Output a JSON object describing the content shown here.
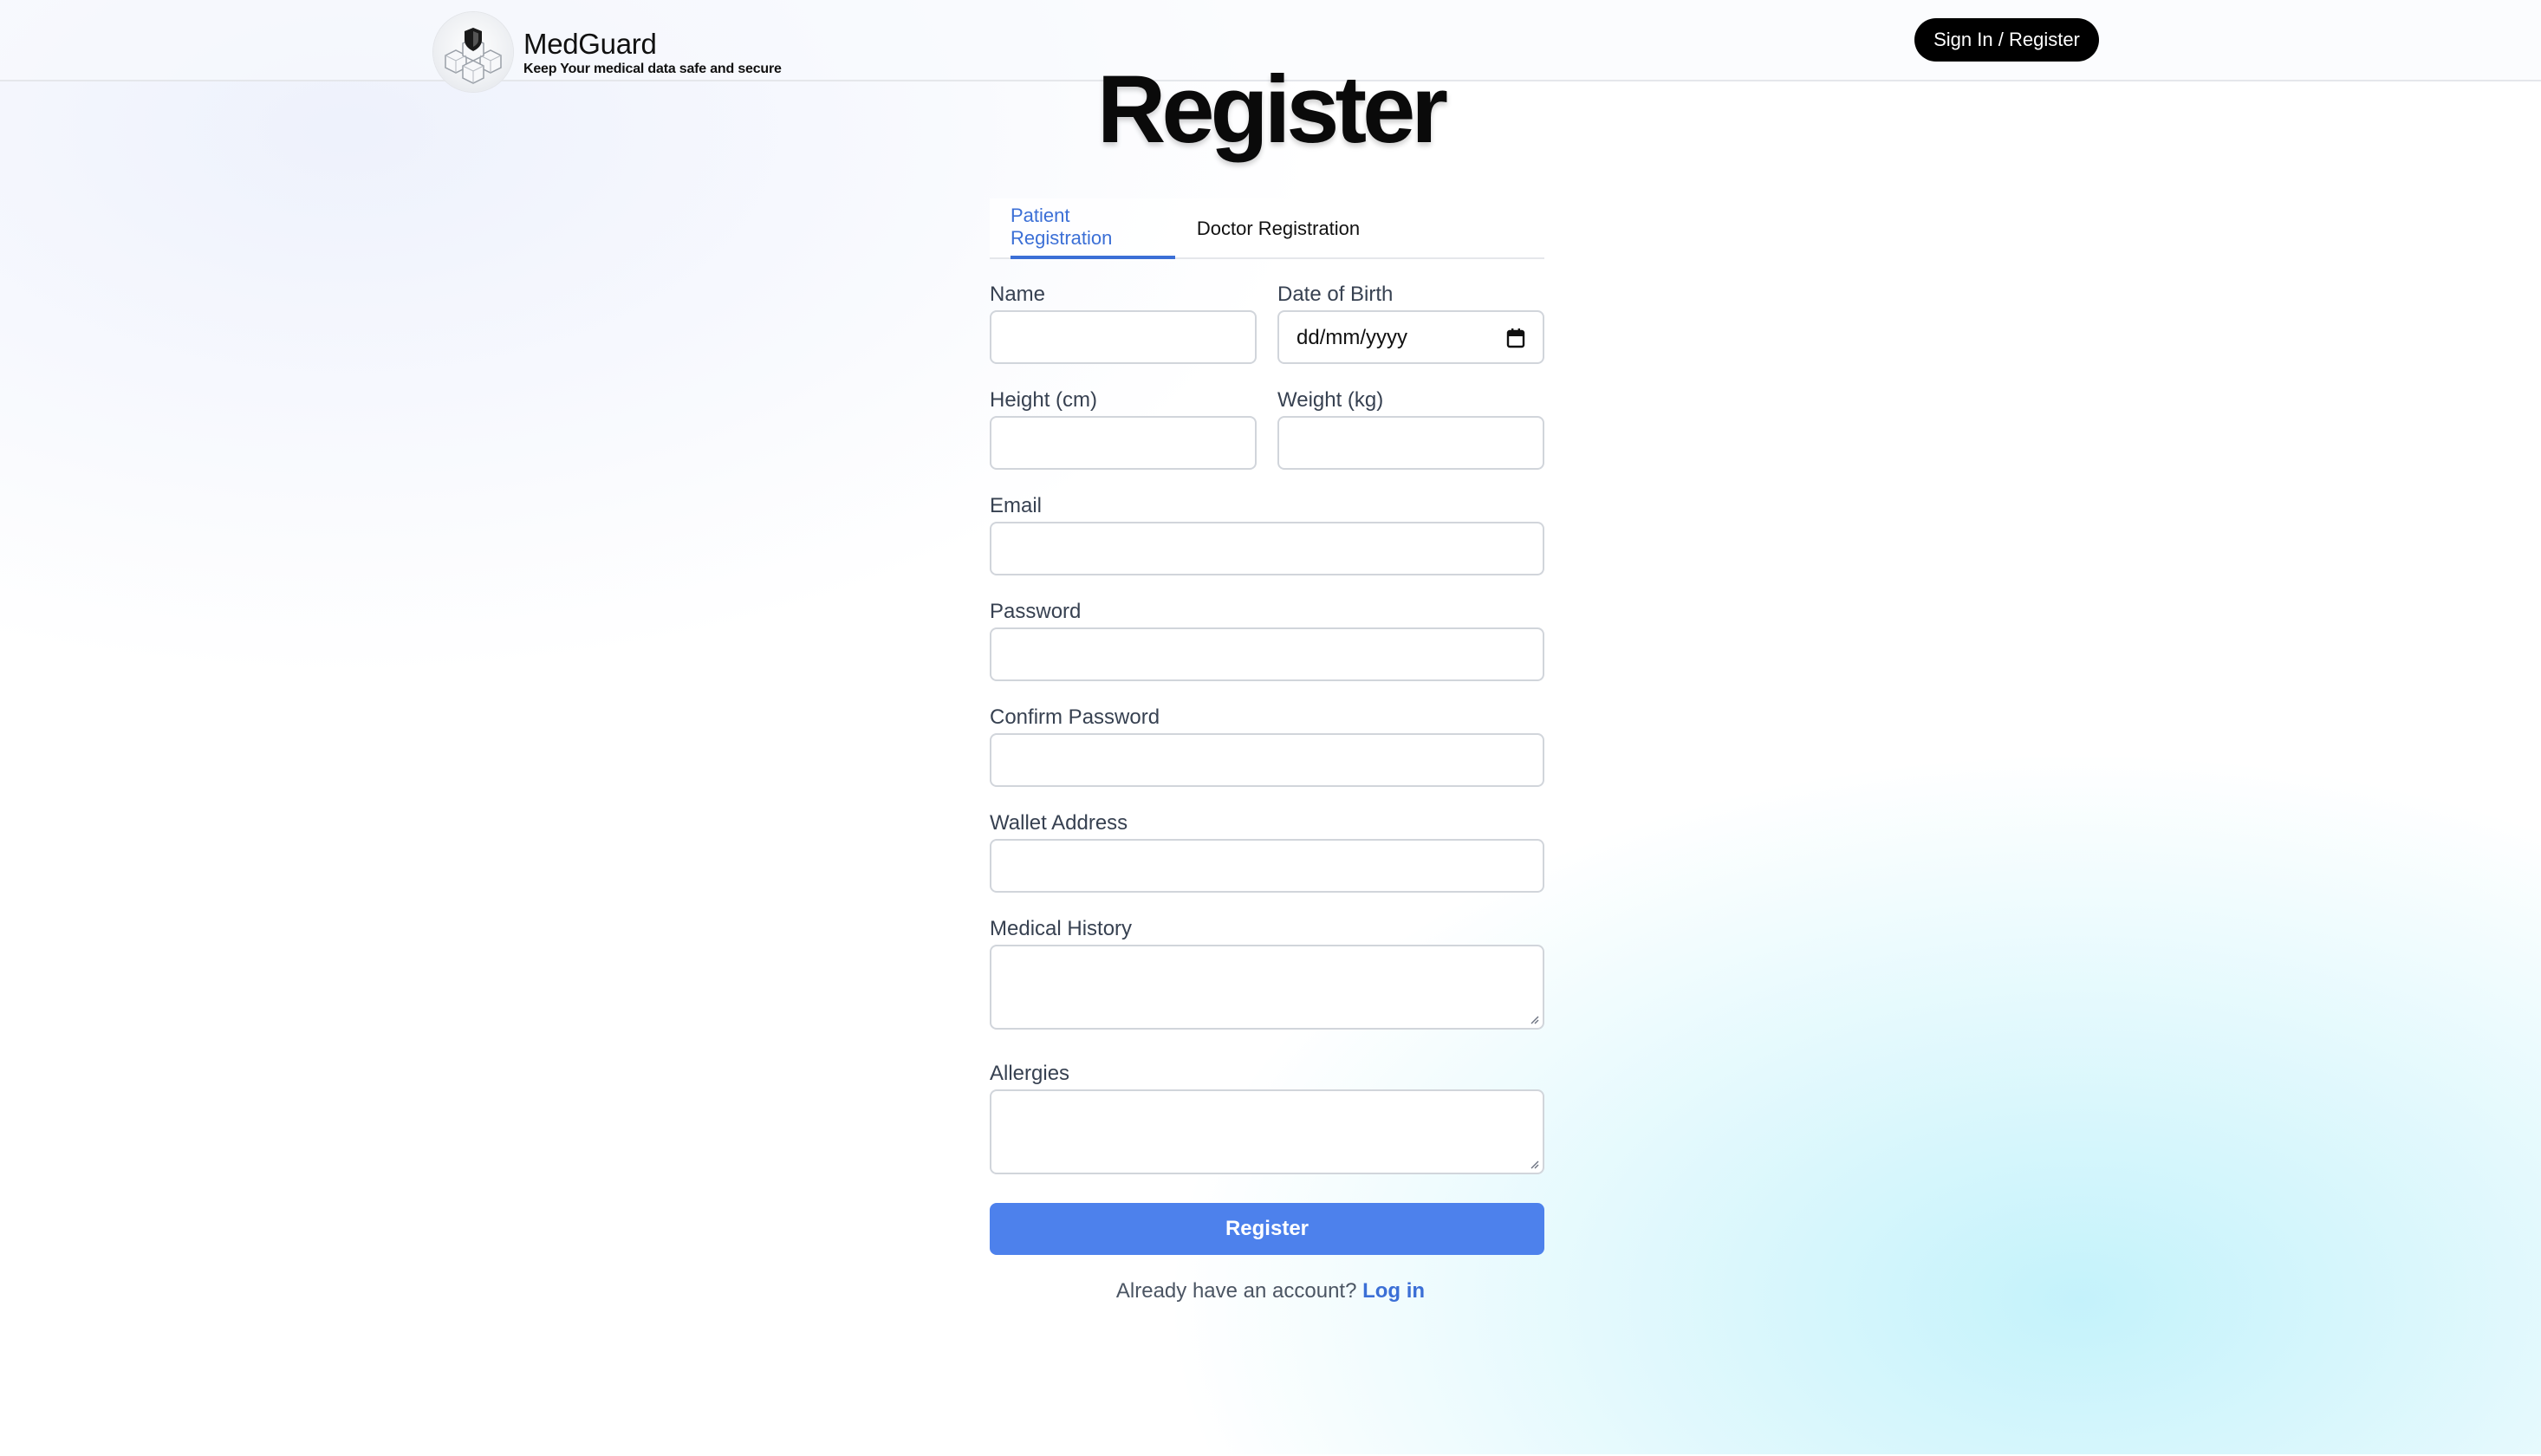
{
  "header": {
    "brand_name": "MedGuard",
    "tagline": "Keep Your medical data safe and secure",
    "signin_label": "Sign In / Register"
  },
  "page": {
    "title": "Register"
  },
  "tabs": [
    {
      "label": "Patient Registration",
      "active": true
    },
    {
      "label": "Doctor Registration",
      "active": false
    }
  ],
  "form": {
    "name_label": "Name",
    "name_value": "",
    "dob_label": "Date of Birth",
    "dob_placeholder": "dd/mm/yyyy",
    "height_label": "Height (cm)",
    "height_value": "",
    "weight_label": "Weight (kg)",
    "weight_value": "",
    "email_label": "Email",
    "email_value": "",
    "password_label": "Password",
    "password_value": "",
    "confirm_password_label": "Confirm Password",
    "confirm_password_value": "",
    "wallet_label": "Wallet Address",
    "wallet_value": "",
    "medical_history_label": "Medical History",
    "medical_history_value": "",
    "allergies_label": "Allergies",
    "allergies_value": "",
    "submit_label": "Register"
  },
  "footer": {
    "prompt": "Already have an account?",
    "login_link": "Log in"
  },
  "colors": {
    "accent": "#3b6fd6",
    "button_blue": "#4d81ec",
    "header_button": "#000000"
  },
  "icons": [
    "medguard-logo-icon",
    "calendar-icon",
    "resize-grip-icon"
  ]
}
